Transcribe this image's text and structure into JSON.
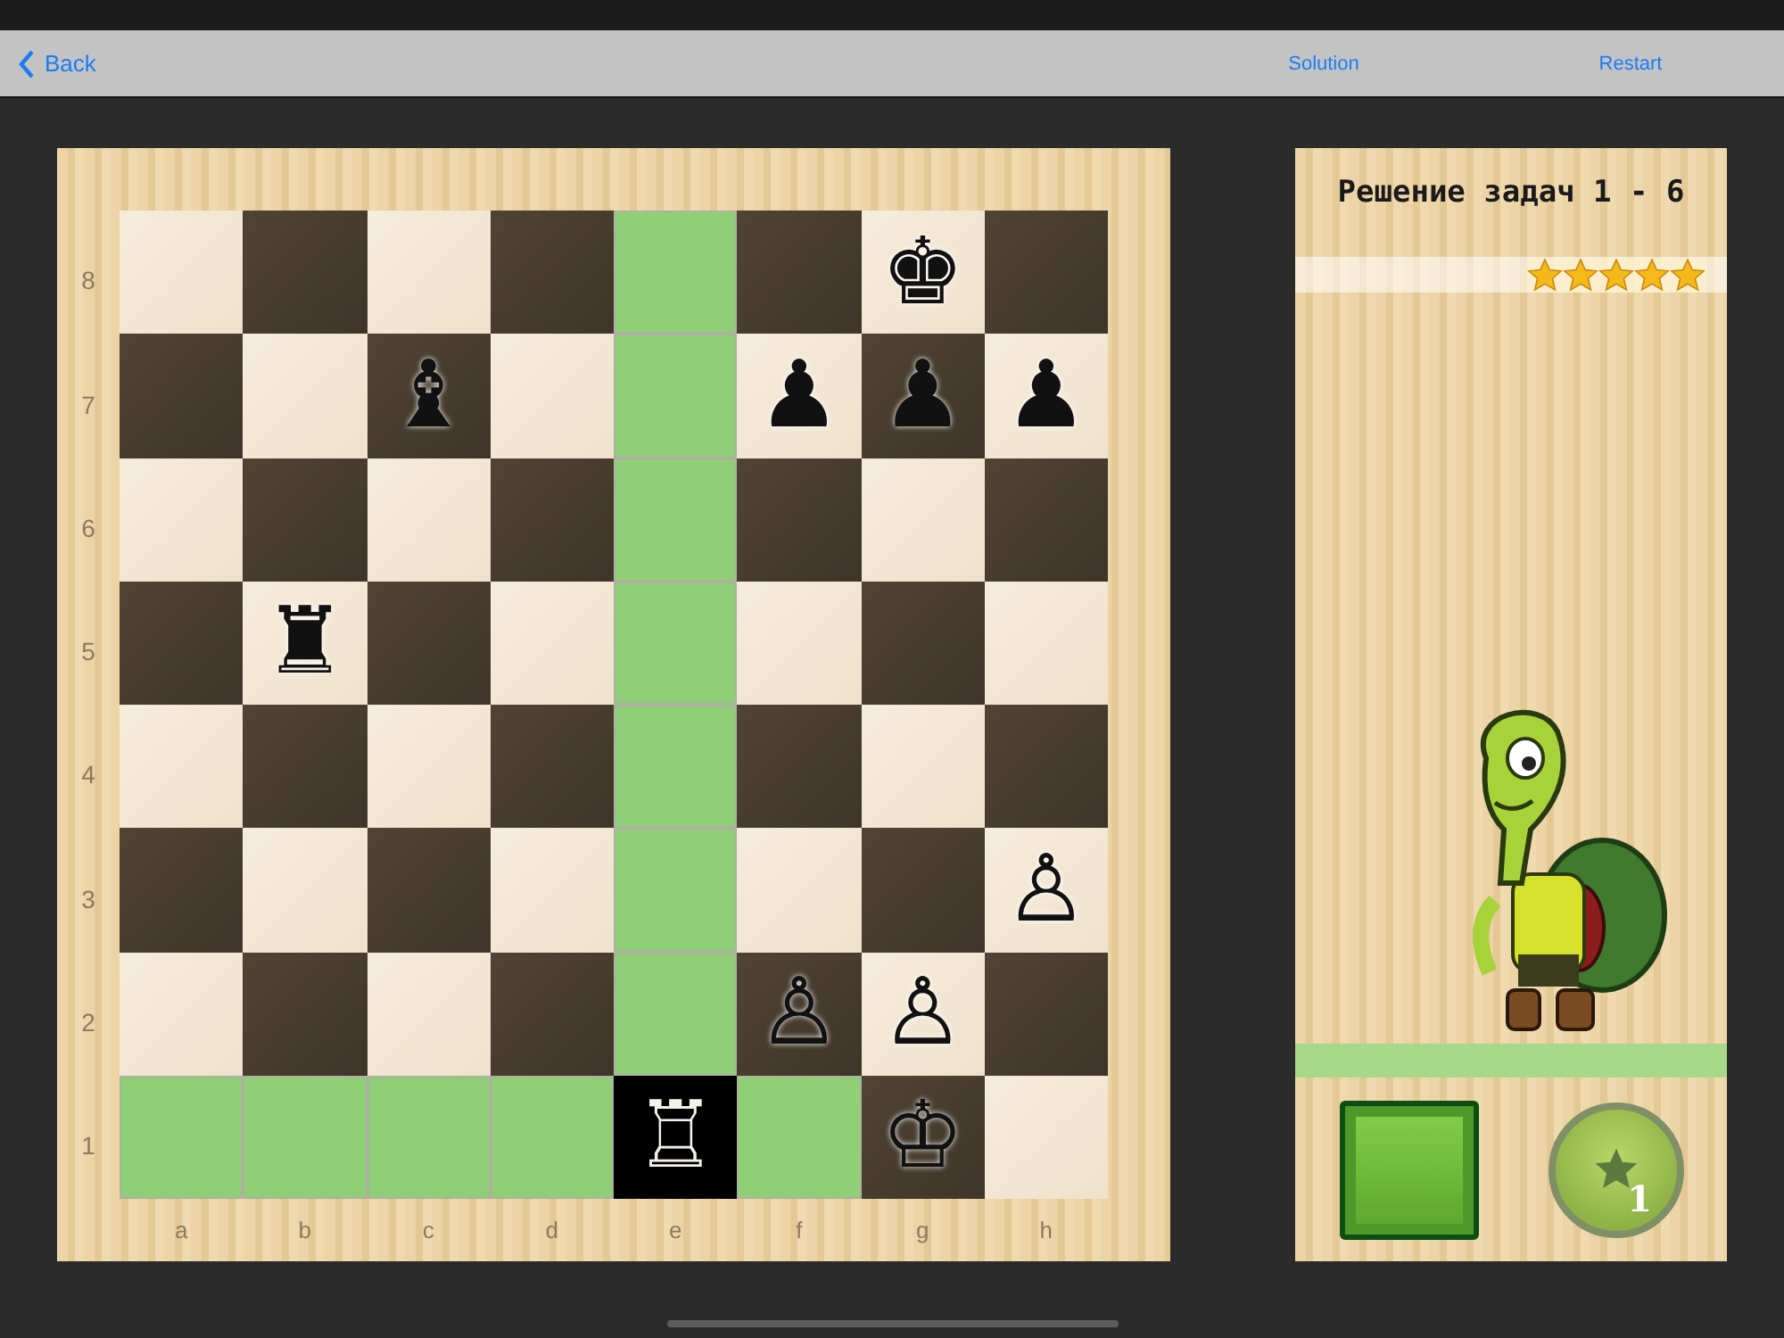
{
  "nav": {
    "back": "Back",
    "actions": [
      "Solution",
      "Restart"
    ]
  },
  "board": {
    "ranks": [
      "8",
      "7",
      "6",
      "5",
      "4",
      "3",
      "2",
      "1"
    ],
    "files": [
      "a",
      "b",
      "c",
      "d",
      "e",
      "f",
      "g",
      "h"
    ],
    "rows": [
      [
        {
          "highlighted": false,
          "selected": false
        },
        {
          "highlighted": false,
          "selected": false
        },
        {
          "highlighted": false,
          "selected": false
        },
        {
          "highlighted": false,
          "selected": false
        },
        {
          "highlighted": true,
          "selected": false
        },
        {
          "highlighted": false,
          "selected": false
        },
        {
          "highlighted": false,
          "selected": false,
          "piece": "♚"
        },
        {
          "highlighted": false,
          "selected": false
        }
      ],
      [
        {
          "highlighted": false,
          "selected": false
        },
        {
          "highlighted": false,
          "selected": false
        },
        {
          "highlighted": false,
          "selected": false,
          "piece": "♝"
        },
        {
          "highlighted": false,
          "selected": false
        },
        {
          "highlighted": true,
          "selected": false
        },
        {
          "highlighted": false,
          "selected": false,
          "piece": "♟"
        },
        {
          "highlighted": false,
          "selected": false,
          "piece": "♟"
        },
        {
          "highlighted": false,
          "selected": false,
          "piece": "♟"
        }
      ],
      [
        {
          "highlighted": false,
          "selected": false
        },
        {
          "highlighted": false,
          "selected": false
        },
        {
          "highlighted": false,
          "selected": false
        },
        {
          "highlighted": false,
          "selected": false
        },
        {
          "highlighted": true,
          "selected": false
        },
        {
          "highlighted": false,
          "selected": false
        },
        {
          "highlighted": false,
          "selected": false
        },
        {
          "highlighted": false,
          "selected": false
        }
      ],
      [
        {
          "highlighted": false,
          "selected": false
        },
        {
          "highlighted": false,
          "selected": false,
          "piece": "♜"
        },
        {
          "highlighted": false,
          "selected": false
        },
        {
          "highlighted": false,
          "selected": false
        },
        {
          "highlighted": true,
          "selected": false
        },
        {
          "highlighted": false,
          "selected": false
        },
        {
          "highlighted": false,
          "selected": false
        },
        {
          "highlighted": false,
          "selected": false
        }
      ],
      [
        {
          "highlighted": false,
          "selected": false
        },
        {
          "highlighted": false,
          "selected": false
        },
        {
          "highlighted": false,
          "selected": false
        },
        {
          "highlighted": false,
          "selected": false
        },
        {
          "highlighted": true,
          "selected": false
        },
        {
          "highlighted": false,
          "selected": false
        },
        {
          "highlighted": false,
          "selected": false
        },
        {
          "highlighted": false,
          "selected": false
        }
      ],
      [
        {
          "highlighted": false,
          "selected": false
        },
        {
          "highlighted": false,
          "selected": false
        },
        {
          "highlighted": false,
          "selected": false
        },
        {
          "highlighted": false,
          "selected": false
        },
        {
          "highlighted": true,
          "selected": false
        },
        {
          "highlighted": false,
          "selected": false
        },
        {
          "highlighted": false,
          "selected": false
        },
        {
          "highlighted": false,
          "selected": false,
          "piece": "♙"
        }
      ],
      [
        {
          "highlighted": false,
          "selected": false
        },
        {
          "highlighted": false,
          "selected": false
        },
        {
          "highlighted": false,
          "selected": false
        },
        {
          "highlighted": false,
          "selected": false
        },
        {
          "highlighted": true,
          "selected": false
        },
        {
          "highlighted": false,
          "selected": false,
          "piece": "♙"
        },
        {
          "highlighted": false,
          "selected": false,
          "piece": "♙"
        },
        {
          "highlighted": false,
          "selected": false
        }
      ],
      [
        {
          "highlighted": true,
          "selected": false
        },
        {
          "highlighted": true,
          "selected": false
        },
        {
          "highlighted": true,
          "selected": false
        },
        {
          "highlighted": true,
          "selected": false
        },
        {
          "highlighted": false,
          "selected": true,
          "piece": "♖"
        },
        {
          "highlighted": true,
          "selected": false
        },
        {
          "highlighted": false,
          "selected": false,
          "piece": "♔"
        },
        {
          "highlighted": false,
          "selected": false
        }
      ]
    ]
  },
  "panel": {
    "title": "Решение задач 1 - 6",
    "stars": 5,
    "hint_count": "1"
  }
}
